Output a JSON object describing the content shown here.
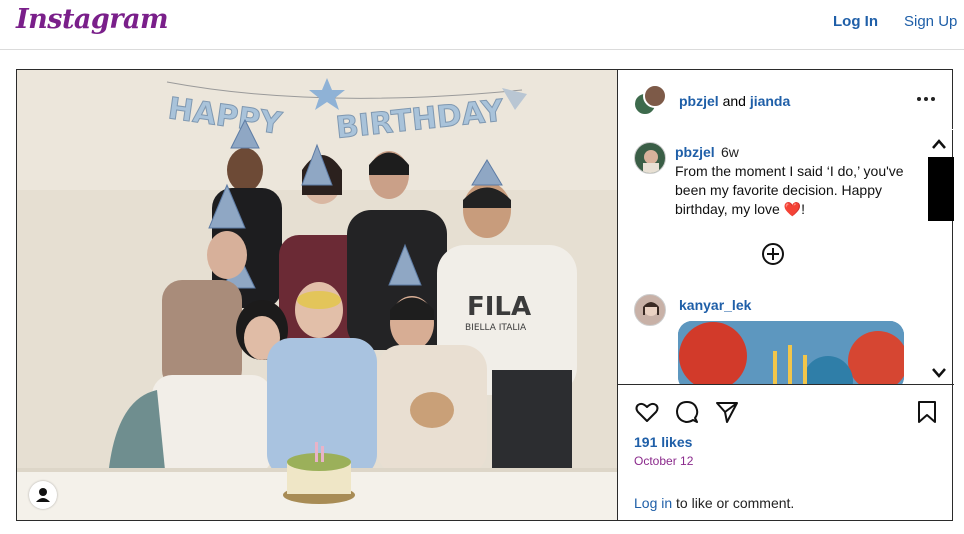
{
  "header": {
    "logo": "Instagram",
    "login_label": "Log In",
    "signup_label": "Sign Up"
  },
  "photo": {
    "banner_left": "HAPPY",
    "banner_right": "BIRTHDAY",
    "shirt_text": "FILA",
    "shirt_subtext": "BIELLA ITALIA"
  },
  "post_header": {
    "author": "pbzjel",
    "joiner": "and",
    "coauthor": "jianda"
  },
  "caption": {
    "username": "pbzjel",
    "time": "6w",
    "text": "From the moment I said ‘I do,’ you've been my favorite decision. Happy birthday, my love ",
    "emoji": "❤️",
    "tail": "!"
  },
  "comment2": {
    "username": "kanyar_lek"
  },
  "actions": {
    "likes": "191 likes",
    "date": "October 12",
    "login_link": "Log in",
    "login_rest": " to like or comment."
  },
  "icons": [
    "heart-icon",
    "comment-icon",
    "share-icon",
    "bookmark-icon",
    "more-icon",
    "plus-circle-icon",
    "chevron-up-icon",
    "chevron-down-icon",
    "user-tag-icon"
  ]
}
